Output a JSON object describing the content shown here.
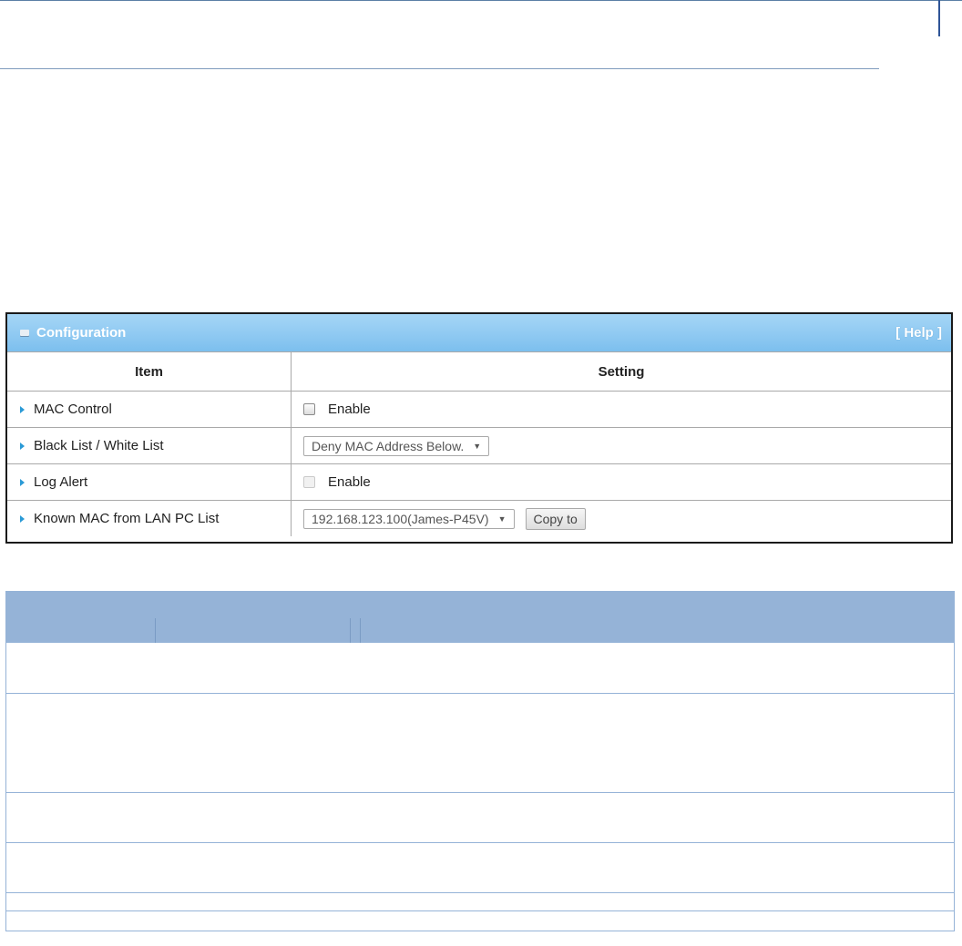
{
  "config": {
    "title": "Configuration",
    "help_label": "[ Help ]",
    "header": {
      "item": "Item",
      "setting": "Setting"
    },
    "rows": [
      {
        "label": "MAC Control",
        "type": "checkbox",
        "option_label": "Enable",
        "checked": false,
        "enabled": true
      },
      {
        "label": "Black List / White List",
        "type": "select",
        "selected": "Deny MAC Address Below."
      },
      {
        "label": "Log Alert",
        "type": "checkbox",
        "option_label": "Enable",
        "checked": false,
        "enabled": false
      },
      {
        "label": "Known MAC from LAN PC List",
        "type": "select+button",
        "selected": "192.168.123.100(James-P45V)",
        "button_label": "Copy to"
      }
    ]
  },
  "colors": {
    "panel_header": "#7cbfee",
    "table_header": "#95b3d7",
    "arrow": "#2a9ad6"
  }
}
